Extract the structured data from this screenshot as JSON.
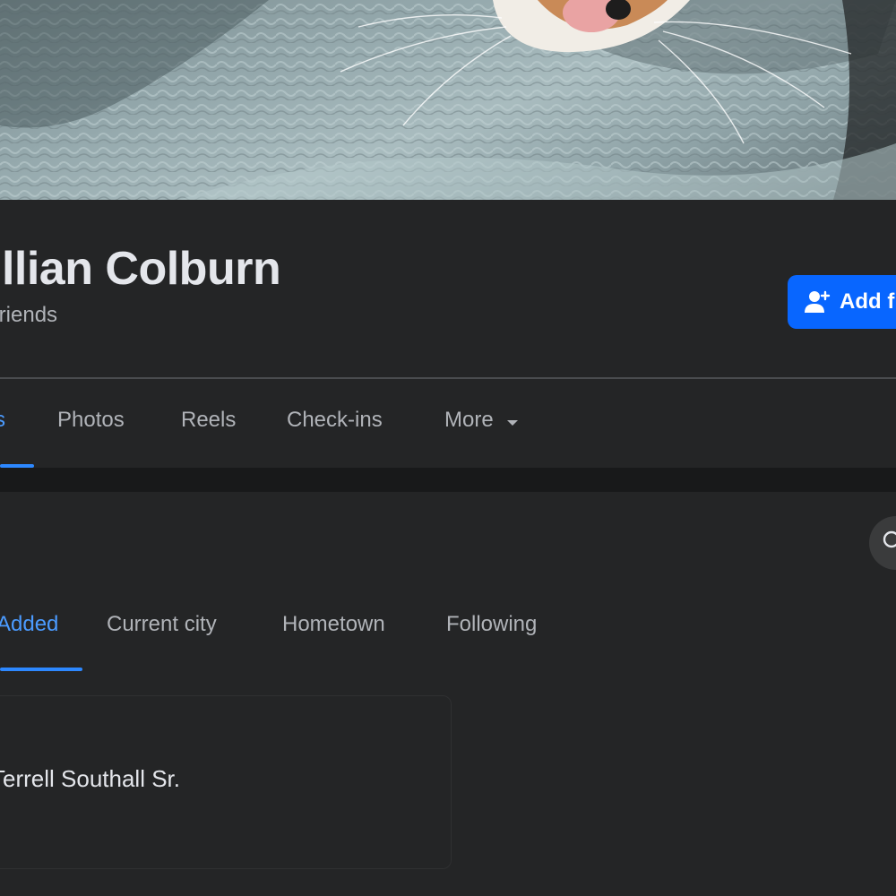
{
  "profile": {
    "name": "illian Colburn",
    "friends_text": "friends"
  },
  "actions": {
    "add_friend_label": "Add f"
  },
  "tabs": [
    {
      "label": "s",
      "active": true
    },
    {
      "label": "Photos",
      "active": false
    },
    {
      "label": "Reels",
      "active": false
    },
    {
      "label": "Check-ins",
      "active": false
    },
    {
      "label": "More",
      "active": false
    }
  ],
  "friends_section": {
    "subtabs": [
      {
        "label": "Added",
        "active": true
      },
      {
        "label": "Current city",
        "active": false
      },
      {
        "label": "Hometown",
        "active": false
      },
      {
        "label": "Following",
        "active": false
      }
    ],
    "cards": [
      {
        "name": "Terrell Southall Sr."
      }
    ]
  },
  "icons": {
    "add_friend": "person-plus-icon",
    "more": "caret-down-icon",
    "search": "search-icon"
  },
  "colors": {
    "accent": "#0866ff",
    "active_tab": "#4b9bff",
    "background": "#242526"
  }
}
